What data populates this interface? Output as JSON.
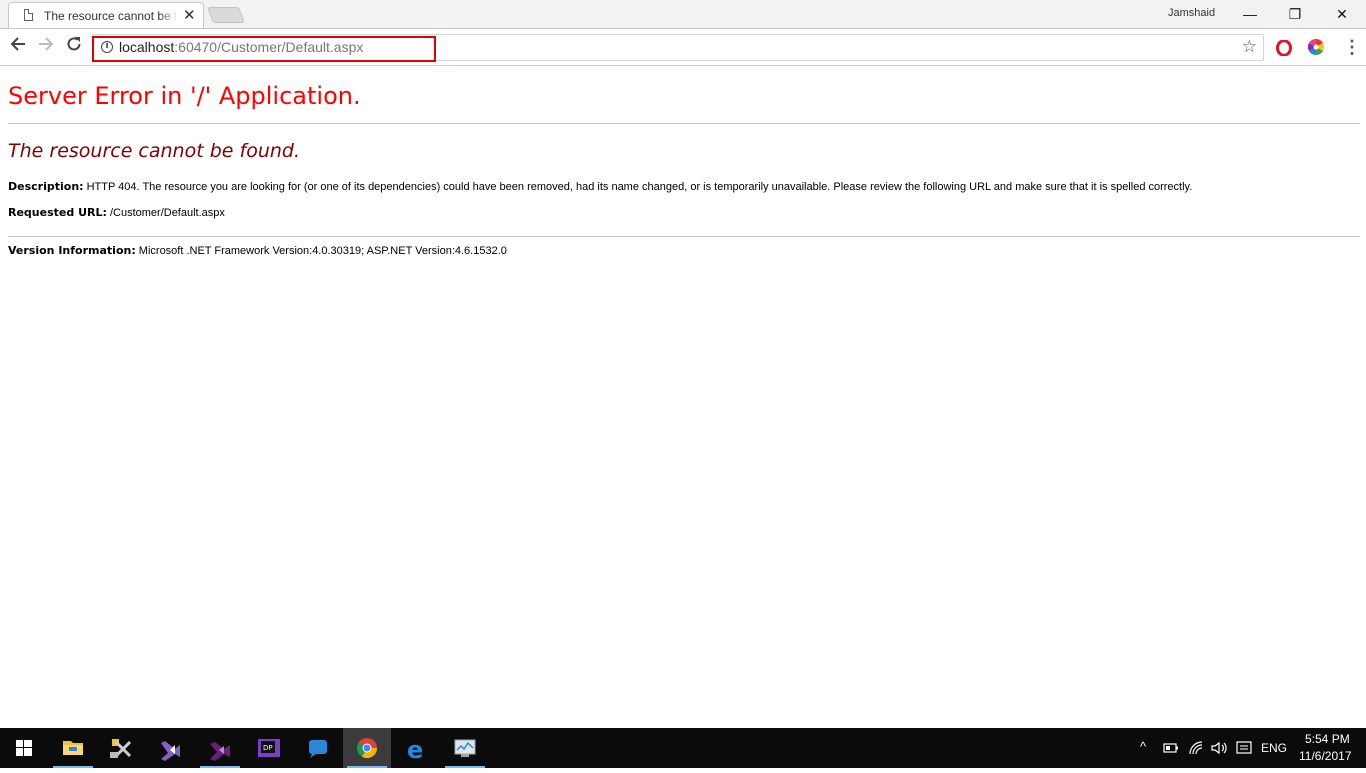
{
  "browser": {
    "tab_title": "The resource cannot be f",
    "profile_name": "Jamshaid",
    "window_controls": {
      "minimize": "—",
      "restore": "❐",
      "close": "✕"
    },
    "url_host": "localhost",
    "url_rest": ":60470/Customer/Default.aspx",
    "icons": [
      "back-arrow-icon",
      "forward-arrow-icon",
      "reload-icon",
      "info-icon",
      "bookmark-star-icon",
      "opera-icon",
      "color-wheel-icon",
      "chrome-menu-icon"
    ]
  },
  "page": {
    "heading": "Server Error in '/' Application.",
    "subheading": "The resource cannot be found.",
    "description_label": "Description:",
    "description_text": "HTTP 404. The resource you are looking for (or one of its dependencies) could have been removed, had its name changed, or is temporarily unavailable.  Please review the following URL and make sure that it is spelled correctly.",
    "requested_url_label": "Requested URL:",
    "requested_url_value": "/Customer/Default.aspx",
    "version_label": "Version Information:",
    "version_text": "Microsoft .NET Framework Version:4.0.30319; ASP.NET Version:4.6.1532.0",
    "heading_color": "#ff0000",
    "subheading_color": "#800000"
  },
  "taskbar": {
    "apps": [
      "windows-start-icon",
      "file-explorer-icon",
      "tools-icon",
      "visual-studio-icon",
      "visual-studio-purple-icon",
      "dotpeek-icon",
      "chat-icon",
      "chrome-icon",
      "edge-icon",
      "performance-monitor-icon"
    ],
    "active_app": "chrome-icon",
    "language": "ENG",
    "time": "5:54 PM",
    "date": "11/6/2017",
    "accent_color": "#76b9ed"
  }
}
